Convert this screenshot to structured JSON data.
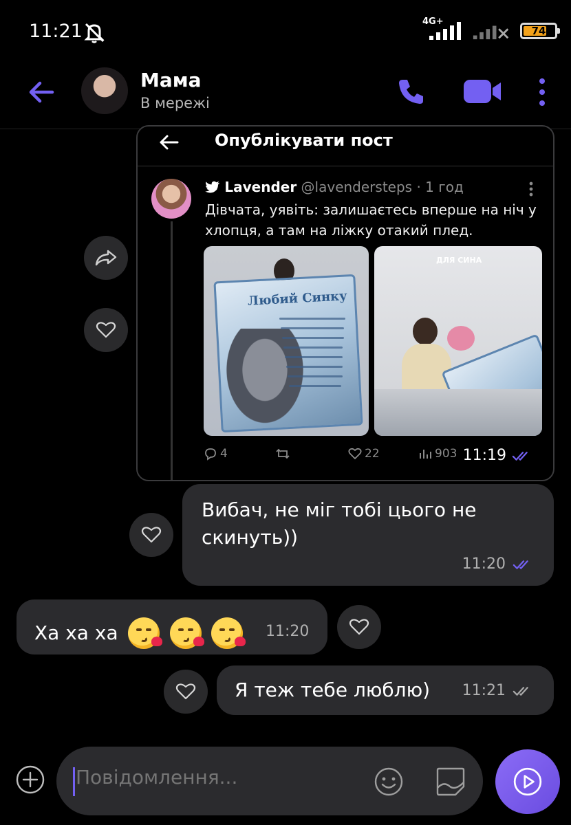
{
  "status_bar": {
    "time": "11:21",
    "network_label": "4G+",
    "battery_level": "74",
    "battery_fraction": 0.74
  },
  "header": {
    "contact_name": "Мама",
    "contact_status": "В мережі"
  },
  "shared_post": {
    "screen_title": "Опублікувати пост",
    "author_name": "Lavender",
    "author_handle": "@lavendersteps",
    "posted_ago": "· 1 год",
    "text": "Дівчата, уявіть: залишаєтесь вперше на ніч у хлопця, а там на ліжку отакий плед.",
    "image_1_blanket_title": "Любий Синку",
    "image_2_caption": "ДЛЯ СИНА",
    "replies": "4",
    "retweets": "",
    "likes": "22",
    "views": "903",
    "message_time": "11:19"
  },
  "messages": [
    {
      "direction": "outgoing",
      "text": "Вибач, не міг тобі цього не скинуть))",
      "time": "11:20",
      "status": "read"
    },
    {
      "direction": "incoming",
      "text": "Ха ха ха",
      "emoji_count": 3,
      "time": "11:20"
    },
    {
      "direction": "outgoing",
      "text": "Я теж тебе люблю)",
      "time": "11:21",
      "status": "delivered"
    }
  ],
  "composer": {
    "placeholder": "Повідомлення..."
  },
  "colors": {
    "accent": "#7360f2",
    "bubble": "#2b2b2e",
    "background": "#000000",
    "battery": "#f3a21b"
  },
  "icons": [
    "back-arrow-icon",
    "phone-icon",
    "video-camera-icon",
    "more-vert-icon",
    "share-forward-icon",
    "heart-icon",
    "plus-icon",
    "emoji-icon",
    "sticker-icon",
    "send-icon",
    "double-check-icon"
  ]
}
